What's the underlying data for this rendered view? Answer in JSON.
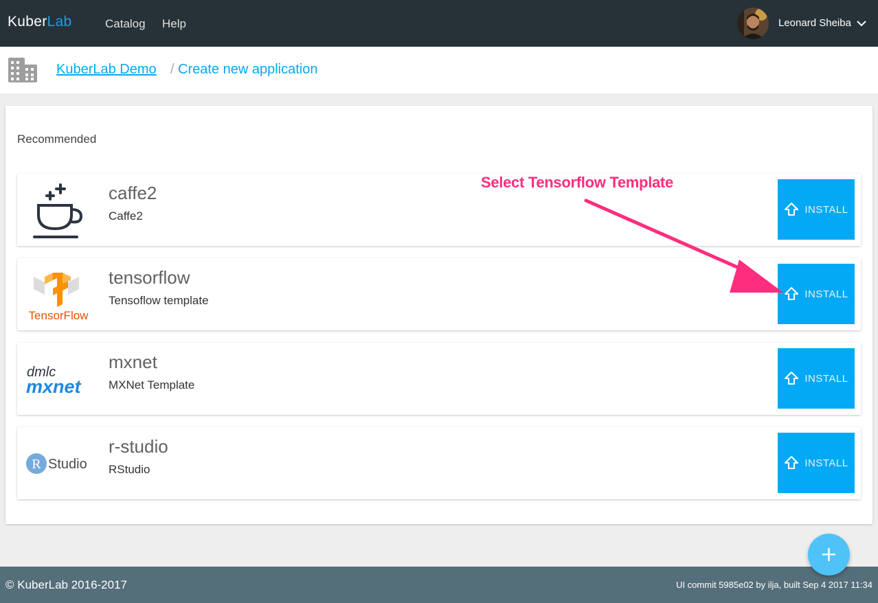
{
  "navbar": {
    "brand_prefix": "Kuber",
    "brand_suffix": "Lab",
    "links": [
      "Catalog",
      "Help"
    ],
    "user_name": "Leonard Sheiba",
    "avatar_icon": "user-avatar",
    "dropdown_icon": "chevron-down-icon"
  },
  "breadcrumb": {
    "org_icon": "building-icon",
    "org_link": "KuberLab Demo",
    "separator": "/",
    "current": "Create new application"
  },
  "main": {
    "section_title": "Recommended",
    "apps": [
      {
        "name": "caffe2",
        "description": "Caffe2",
        "logo": "coffee-cup-icon",
        "install_label": "INSTALL"
      },
      {
        "name": "tensorflow",
        "description": "Tensoflow template",
        "logo": "tensorflow-logo",
        "logo_text": "TensorFlow",
        "install_label": "INSTALL"
      },
      {
        "name": "mxnet",
        "description": "MXNet Template",
        "logo": "mxnet-logo",
        "logo_text_top": "dmlc",
        "logo_text_bottom": "mxnet",
        "install_label": "INSTALL"
      },
      {
        "name": "r-studio",
        "description": "RStudio",
        "logo": "rstudio-logo",
        "logo_text": "Studio",
        "logo_letter": "R",
        "install_label": "INSTALL"
      }
    ],
    "install_icon": "upload-arrow-icon"
  },
  "annotation": {
    "text": "Select Tensorflow Template",
    "color": "#ff2d7e"
  },
  "fab": {
    "icon": "plus-icon",
    "glyph": "+"
  },
  "footer": {
    "copyright": "© KuberLab 2016-2017",
    "build_info": "UI commit 5985e02 by ilja, built Sep 4 2017 11:34"
  },
  "colors": {
    "navbar_bg": "#263238",
    "accent": "#03a9f4",
    "footer_bg": "#546e7a",
    "fab_bg": "#4fc3f7"
  }
}
